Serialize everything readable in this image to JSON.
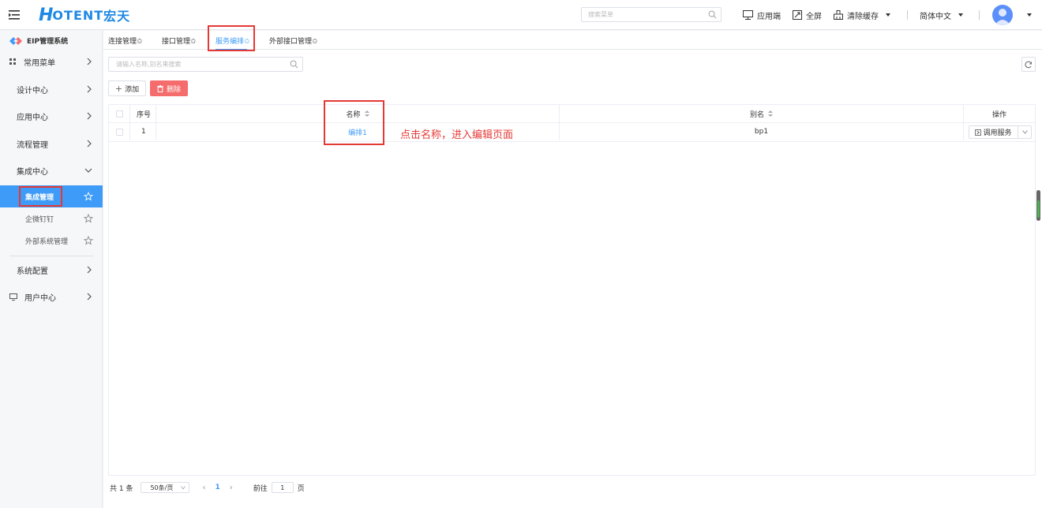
{
  "header": {
    "logo_h": "H",
    "logo_text": "OTENT",
    "logo_cn": "宏天",
    "search_placeholder": "搜索菜单",
    "app_end": "应用端",
    "fullscreen": "全屏",
    "clear_cache": "清除缓存",
    "language": "简体中文"
  },
  "sidebar": {
    "system_title": "EIP管理系统",
    "items": [
      {
        "label": "常用菜单"
      },
      {
        "label": "设计中心"
      },
      {
        "label": "应用中心"
      },
      {
        "label": "流程管理"
      },
      {
        "label": "集成中心"
      },
      {
        "label": "系统配置"
      },
      {
        "label": "用户中心"
      }
    ],
    "sub_items": [
      {
        "label": "集成管理"
      },
      {
        "label": "企微钉钉"
      },
      {
        "label": "外部系统管理"
      }
    ]
  },
  "tabs": [
    {
      "label": "连接管理✩"
    },
    {
      "label": "接口管理✩"
    },
    {
      "label": "服务编排✩"
    },
    {
      "label": "外部接口管理✩"
    }
  ],
  "filter": {
    "placeholder": "请输入名称,别名来搜索"
  },
  "toolbar": {
    "add_label": "添加",
    "delete_label": "删除"
  },
  "table": {
    "headers": {
      "index": "序号",
      "name": "名称",
      "alias": "别名",
      "ops": "操作"
    },
    "rows": [
      {
        "index": "1",
        "name": "编排1",
        "alias": "bp1",
        "op_label": "调用服务"
      }
    ]
  },
  "annotation": "点击名称，进入编辑页面",
  "pager": {
    "total": "共 1 条",
    "page_size": "50条/页",
    "current_page": "1",
    "goto_label": "前往",
    "goto_value": "1",
    "page_suffix": "页"
  },
  "colors": {
    "accent": "#3e9bf7",
    "danger": "#f56c6c",
    "annotation": "#e53935"
  }
}
